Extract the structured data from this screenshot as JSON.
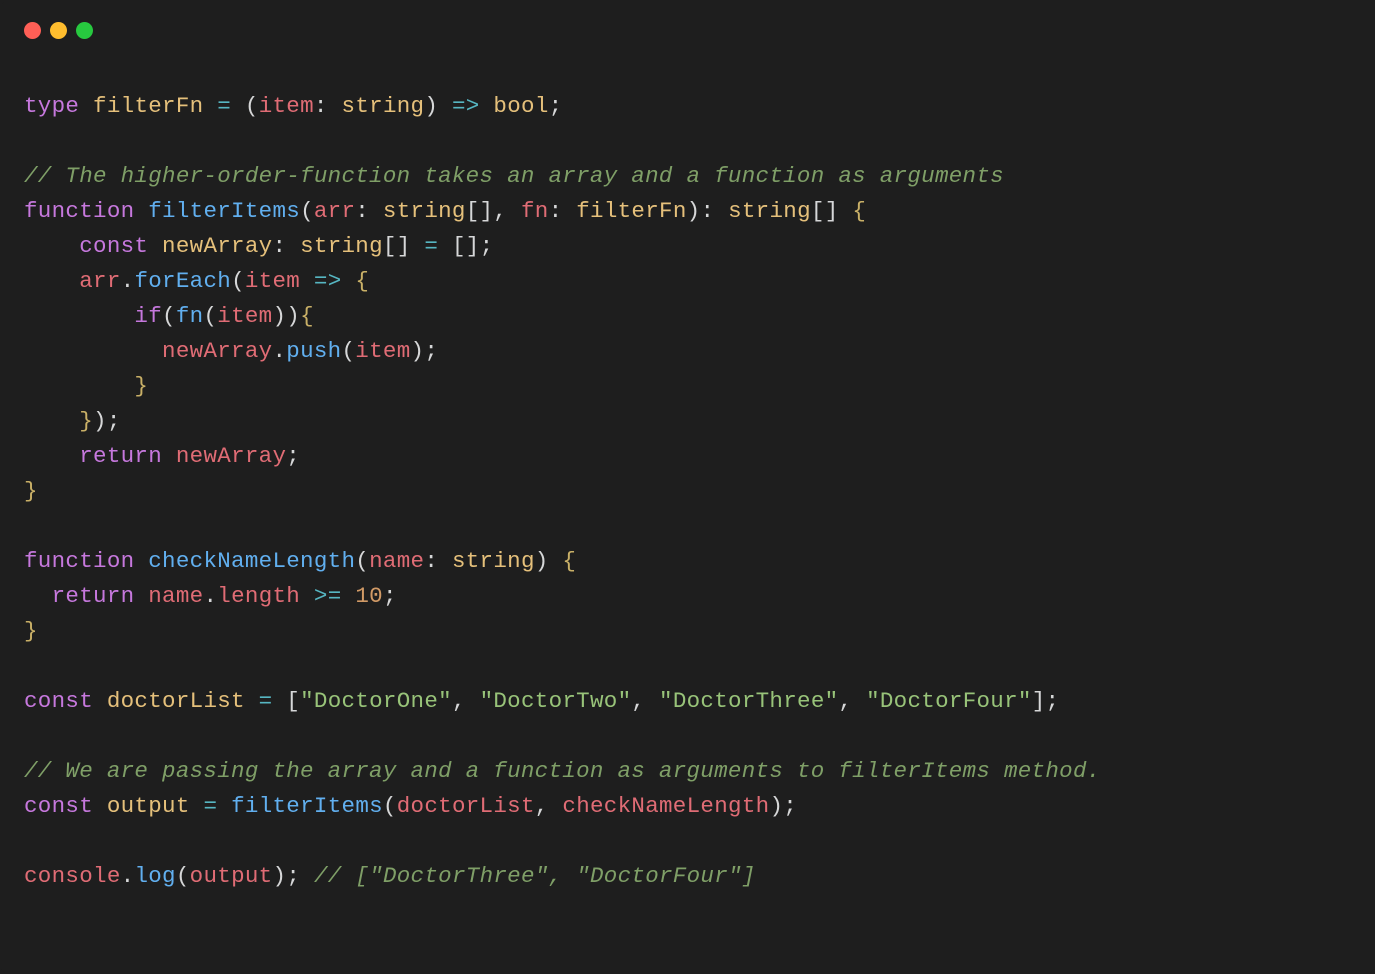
{
  "titlebar": {
    "dots": [
      "close",
      "minimize",
      "zoom"
    ]
  },
  "code": {
    "tokens": [
      [
        [
          "keyword",
          "type"
        ],
        [
          "plain",
          " "
        ],
        [
          "var",
          "filterFn"
        ],
        [
          "plain",
          " "
        ],
        [
          "op",
          "="
        ],
        [
          "plain",
          " "
        ],
        [
          "punct",
          "("
        ],
        [
          "param",
          "item"
        ],
        [
          "punct",
          ":"
        ],
        [
          "plain",
          " "
        ],
        [
          "type",
          "string"
        ],
        [
          "punct",
          ")"
        ],
        [
          "plain",
          " "
        ],
        [
          "op",
          "=>"
        ],
        [
          "plain",
          " "
        ],
        [
          "type",
          "bool"
        ],
        [
          "punct",
          ";"
        ]
      ],
      [],
      [
        [
          "comment",
          "// The higher-order-function takes an array and a function as arguments"
        ]
      ],
      [
        [
          "keyword",
          "function"
        ],
        [
          "plain",
          " "
        ],
        [
          "fn",
          "filterItems"
        ],
        [
          "punct",
          "("
        ],
        [
          "param",
          "arr"
        ],
        [
          "punct",
          ":"
        ],
        [
          "plain",
          " "
        ],
        [
          "type",
          "string"
        ],
        [
          "punct",
          "[]"
        ],
        [
          "punct",
          ","
        ],
        [
          "plain",
          " "
        ],
        [
          "param",
          "fn"
        ],
        [
          "punct",
          ":"
        ],
        [
          "plain",
          " "
        ],
        [
          "type",
          "filterFn"
        ],
        [
          "punct",
          ")"
        ],
        [
          "punct",
          ":"
        ],
        [
          "plain",
          " "
        ],
        [
          "type",
          "string"
        ],
        [
          "punct",
          "[]"
        ],
        [
          "plain",
          " "
        ],
        [
          "bracket",
          "{"
        ]
      ],
      [
        [
          "plain",
          "    "
        ],
        [
          "keyword",
          "const"
        ],
        [
          "plain",
          " "
        ],
        [
          "var",
          "newArray"
        ],
        [
          "punct",
          ":"
        ],
        [
          "plain",
          " "
        ],
        [
          "type",
          "string"
        ],
        [
          "punct",
          "[]"
        ],
        [
          "plain",
          " "
        ],
        [
          "op",
          "="
        ],
        [
          "plain",
          " "
        ],
        [
          "punct",
          "[]"
        ],
        [
          "punct",
          ";"
        ]
      ],
      [
        [
          "plain",
          "    "
        ],
        [
          "param",
          "arr"
        ],
        [
          "punct",
          "."
        ],
        [
          "fn",
          "forEach"
        ],
        [
          "punct",
          "("
        ],
        [
          "param",
          "item"
        ],
        [
          "plain",
          " "
        ],
        [
          "op",
          "=>"
        ],
        [
          "plain",
          " "
        ],
        [
          "bracket",
          "{"
        ]
      ],
      [
        [
          "plain",
          "        "
        ],
        [
          "keyword",
          "if"
        ],
        [
          "punct",
          "("
        ],
        [
          "fn",
          "fn"
        ],
        [
          "punct",
          "("
        ],
        [
          "param",
          "item"
        ],
        [
          "punct",
          ")"
        ],
        [
          "punct",
          ")"
        ],
        [
          "bracket",
          "{"
        ]
      ],
      [
        [
          "plain",
          "          "
        ],
        [
          "param",
          "newArray"
        ],
        [
          "punct",
          "."
        ],
        [
          "fn",
          "push"
        ],
        [
          "punct",
          "("
        ],
        [
          "param",
          "item"
        ],
        [
          "punct",
          ")"
        ],
        [
          "punct",
          ";"
        ]
      ],
      [
        [
          "plain",
          "        "
        ],
        [
          "bracket",
          "}"
        ]
      ],
      [
        [
          "plain",
          "    "
        ],
        [
          "bracket",
          "}"
        ],
        [
          "punct",
          ")"
        ],
        [
          "punct",
          ";"
        ]
      ],
      [
        [
          "plain",
          "    "
        ],
        [
          "keyword",
          "return"
        ],
        [
          "plain",
          " "
        ],
        [
          "param",
          "newArray"
        ],
        [
          "punct",
          ";"
        ]
      ],
      [
        [
          "bracket",
          "}"
        ]
      ],
      [],
      [
        [
          "keyword",
          "function"
        ],
        [
          "plain",
          " "
        ],
        [
          "fn",
          "checkNameLength"
        ],
        [
          "punct",
          "("
        ],
        [
          "param",
          "name"
        ],
        [
          "punct",
          ":"
        ],
        [
          "plain",
          " "
        ],
        [
          "type",
          "string"
        ],
        [
          "punct",
          ")"
        ],
        [
          "plain",
          " "
        ],
        [
          "bracket",
          "{"
        ]
      ],
      [
        [
          "plain",
          "  "
        ],
        [
          "keyword",
          "return"
        ],
        [
          "plain",
          " "
        ],
        [
          "param",
          "name"
        ],
        [
          "punct",
          "."
        ],
        [
          "param",
          "length"
        ],
        [
          "plain",
          " "
        ],
        [
          "op",
          ">="
        ],
        [
          "plain",
          " "
        ],
        [
          "num",
          "10"
        ],
        [
          "punct",
          ";"
        ]
      ],
      [
        [
          "bracket",
          "}"
        ]
      ],
      [],
      [
        [
          "keyword",
          "const"
        ],
        [
          "plain",
          " "
        ],
        [
          "var",
          "doctorList"
        ],
        [
          "plain",
          " "
        ],
        [
          "op",
          "="
        ],
        [
          "plain",
          " "
        ],
        [
          "punct",
          "["
        ],
        [
          "string",
          "\"DoctorOne\""
        ],
        [
          "punct",
          ","
        ],
        [
          "plain",
          " "
        ],
        [
          "string",
          "\"DoctorTwo\""
        ],
        [
          "punct",
          ","
        ],
        [
          "plain",
          " "
        ],
        [
          "string",
          "\"DoctorThree\""
        ],
        [
          "punct",
          ","
        ],
        [
          "plain",
          " "
        ],
        [
          "string",
          "\"DoctorFour\""
        ],
        [
          "punct",
          "]"
        ],
        [
          "punct",
          ";"
        ]
      ],
      [],
      [
        [
          "comment",
          "// We are passing the array and a function as arguments to filterItems method."
        ]
      ],
      [
        [
          "keyword",
          "const"
        ],
        [
          "plain",
          " "
        ],
        [
          "var",
          "output"
        ],
        [
          "plain",
          " "
        ],
        [
          "op",
          "="
        ],
        [
          "plain",
          " "
        ],
        [
          "fn",
          "filterItems"
        ],
        [
          "punct",
          "("
        ],
        [
          "param",
          "doctorList"
        ],
        [
          "punct",
          ","
        ],
        [
          "plain",
          " "
        ],
        [
          "param",
          "checkNameLength"
        ],
        [
          "punct",
          ")"
        ],
        [
          "punct",
          ";"
        ]
      ],
      [],
      [
        [
          "param",
          "console"
        ],
        [
          "punct",
          "."
        ],
        [
          "fn",
          "log"
        ],
        [
          "punct",
          "("
        ],
        [
          "param",
          "output"
        ],
        [
          "punct",
          ")"
        ],
        [
          "punct",
          ";"
        ],
        [
          "plain",
          " "
        ],
        [
          "comment",
          "// [\"DoctorThree\", \"DoctorFour\"]"
        ]
      ]
    ]
  }
}
